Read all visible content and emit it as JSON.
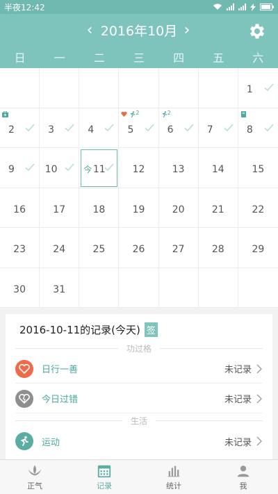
{
  "status": {
    "time": "半夜12:42"
  },
  "header": {
    "title": "2016年10月",
    "prev": "‹",
    "next": "›"
  },
  "weekdays": [
    "日",
    "一",
    "二",
    "三",
    "四",
    "五",
    "六"
  ],
  "calendar": {
    "today_label": "今",
    "cells": [
      {
        "d": ""
      },
      {
        "d": ""
      },
      {
        "d": ""
      },
      {
        "d": ""
      },
      {
        "d": ""
      },
      {
        "d": ""
      },
      {
        "d": "1",
        "check": true
      },
      {
        "d": "2",
        "check": true,
        "mark": "medkit"
      },
      {
        "d": "3",
        "check": true
      },
      {
        "d": "4",
        "check": true
      },
      {
        "d": "5",
        "check": true,
        "mark": "heart-run",
        "count": "2"
      },
      {
        "d": "6",
        "check": true,
        "mark": "run",
        "count": "2"
      },
      {
        "d": "7",
        "check": true
      },
      {
        "d": "8",
        "check": true,
        "mark": "book"
      },
      {
        "d": "9",
        "check": true
      },
      {
        "d": "10",
        "check": true
      },
      {
        "d": "11",
        "check": true,
        "today": true
      },
      {
        "d": "12"
      },
      {
        "d": "13"
      },
      {
        "d": "14"
      },
      {
        "d": "15"
      },
      {
        "d": "16"
      },
      {
        "d": "17"
      },
      {
        "d": "18"
      },
      {
        "d": "19"
      },
      {
        "d": "20"
      },
      {
        "d": "21"
      },
      {
        "d": "22"
      },
      {
        "d": "23"
      },
      {
        "d": "24"
      },
      {
        "d": "25"
      },
      {
        "d": "26"
      },
      {
        "d": "27"
      },
      {
        "d": "28"
      },
      {
        "d": "29"
      },
      {
        "d": "30"
      },
      {
        "d": "31"
      },
      {
        "d": ""
      },
      {
        "d": ""
      },
      {
        "d": ""
      },
      {
        "d": ""
      },
      {
        "d": ""
      }
    ]
  },
  "records": {
    "title": "2016-10-11的记录(今天)",
    "sign": "签",
    "section1": "功过格",
    "section2": "生活",
    "rows": [
      {
        "label": "日行一善",
        "value": "未记录",
        "color": "#ee6b4a"
      },
      {
        "label": "今日过错",
        "value": "未记录",
        "color": "#8e8e8e"
      },
      {
        "label": "运动",
        "value": "未记录",
        "color": "#5aada3"
      }
    ]
  },
  "tabs": [
    {
      "label": "正气",
      "active": false
    },
    {
      "label": "记录",
      "active": true
    },
    {
      "label": "统计",
      "active": false
    },
    {
      "label": "我",
      "active": false
    }
  ],
  "colors": {
    "teal": "#7ec4bc",
    "accent": "#5aada3",
    "heart": "#ee6b4a"
  }
}
